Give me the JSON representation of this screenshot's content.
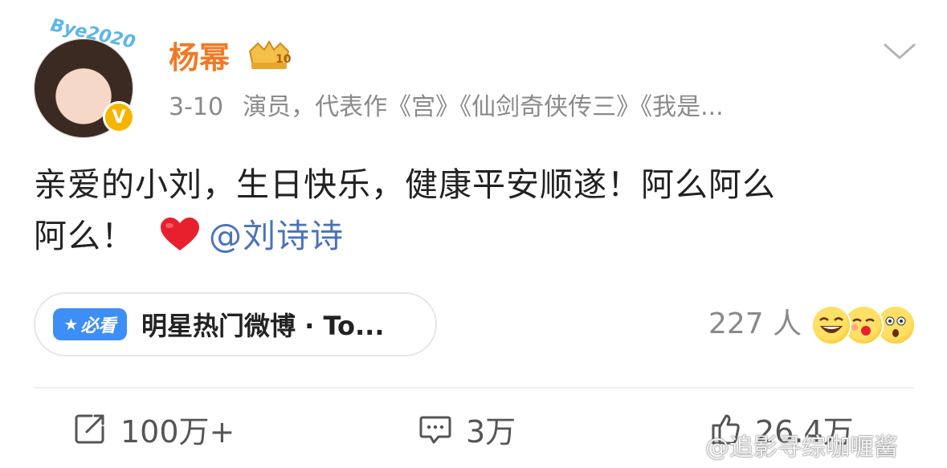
{
  "avatar": {
    "sticker_text": "Bye2020",
    "verified_mark": "V"
  },
  "user": {
    "name": "杨幂",
    "level_badge": "10"
  },
  "meta": {
    "date": "3-10",
    "description": "演员，代表作《宫》《仙剑奇侠传三》《我是..."
  },
  "post": {
    "line1": "亲爱的小刘，生日快乐，健康平安顺遂！阿么阿么",
    "line2": "阿么！",
    "heart_icon": "red-heart-icon",
    "mention": "@刘诗诗"
  },
  "topic": {
    "badge_icon": "star-icon",
    "badge_label": "必看",
    "label": "明星热门微博 · To..."
  },
  "reactions": {
    "count": "227 人"
  },
  "actions": {
    "repost": "100万+",
    "comment": "3万",
    "like": "26.4万"
  },
  "watermark": "@追影寻综咖喱酱",
  "colors": {
    "username": "#f07a24",
    "mention": "#4a73b8",
    "badge_blue": "#3d8ef7",
    "verified_gold": "#f7b500"
  }
}
